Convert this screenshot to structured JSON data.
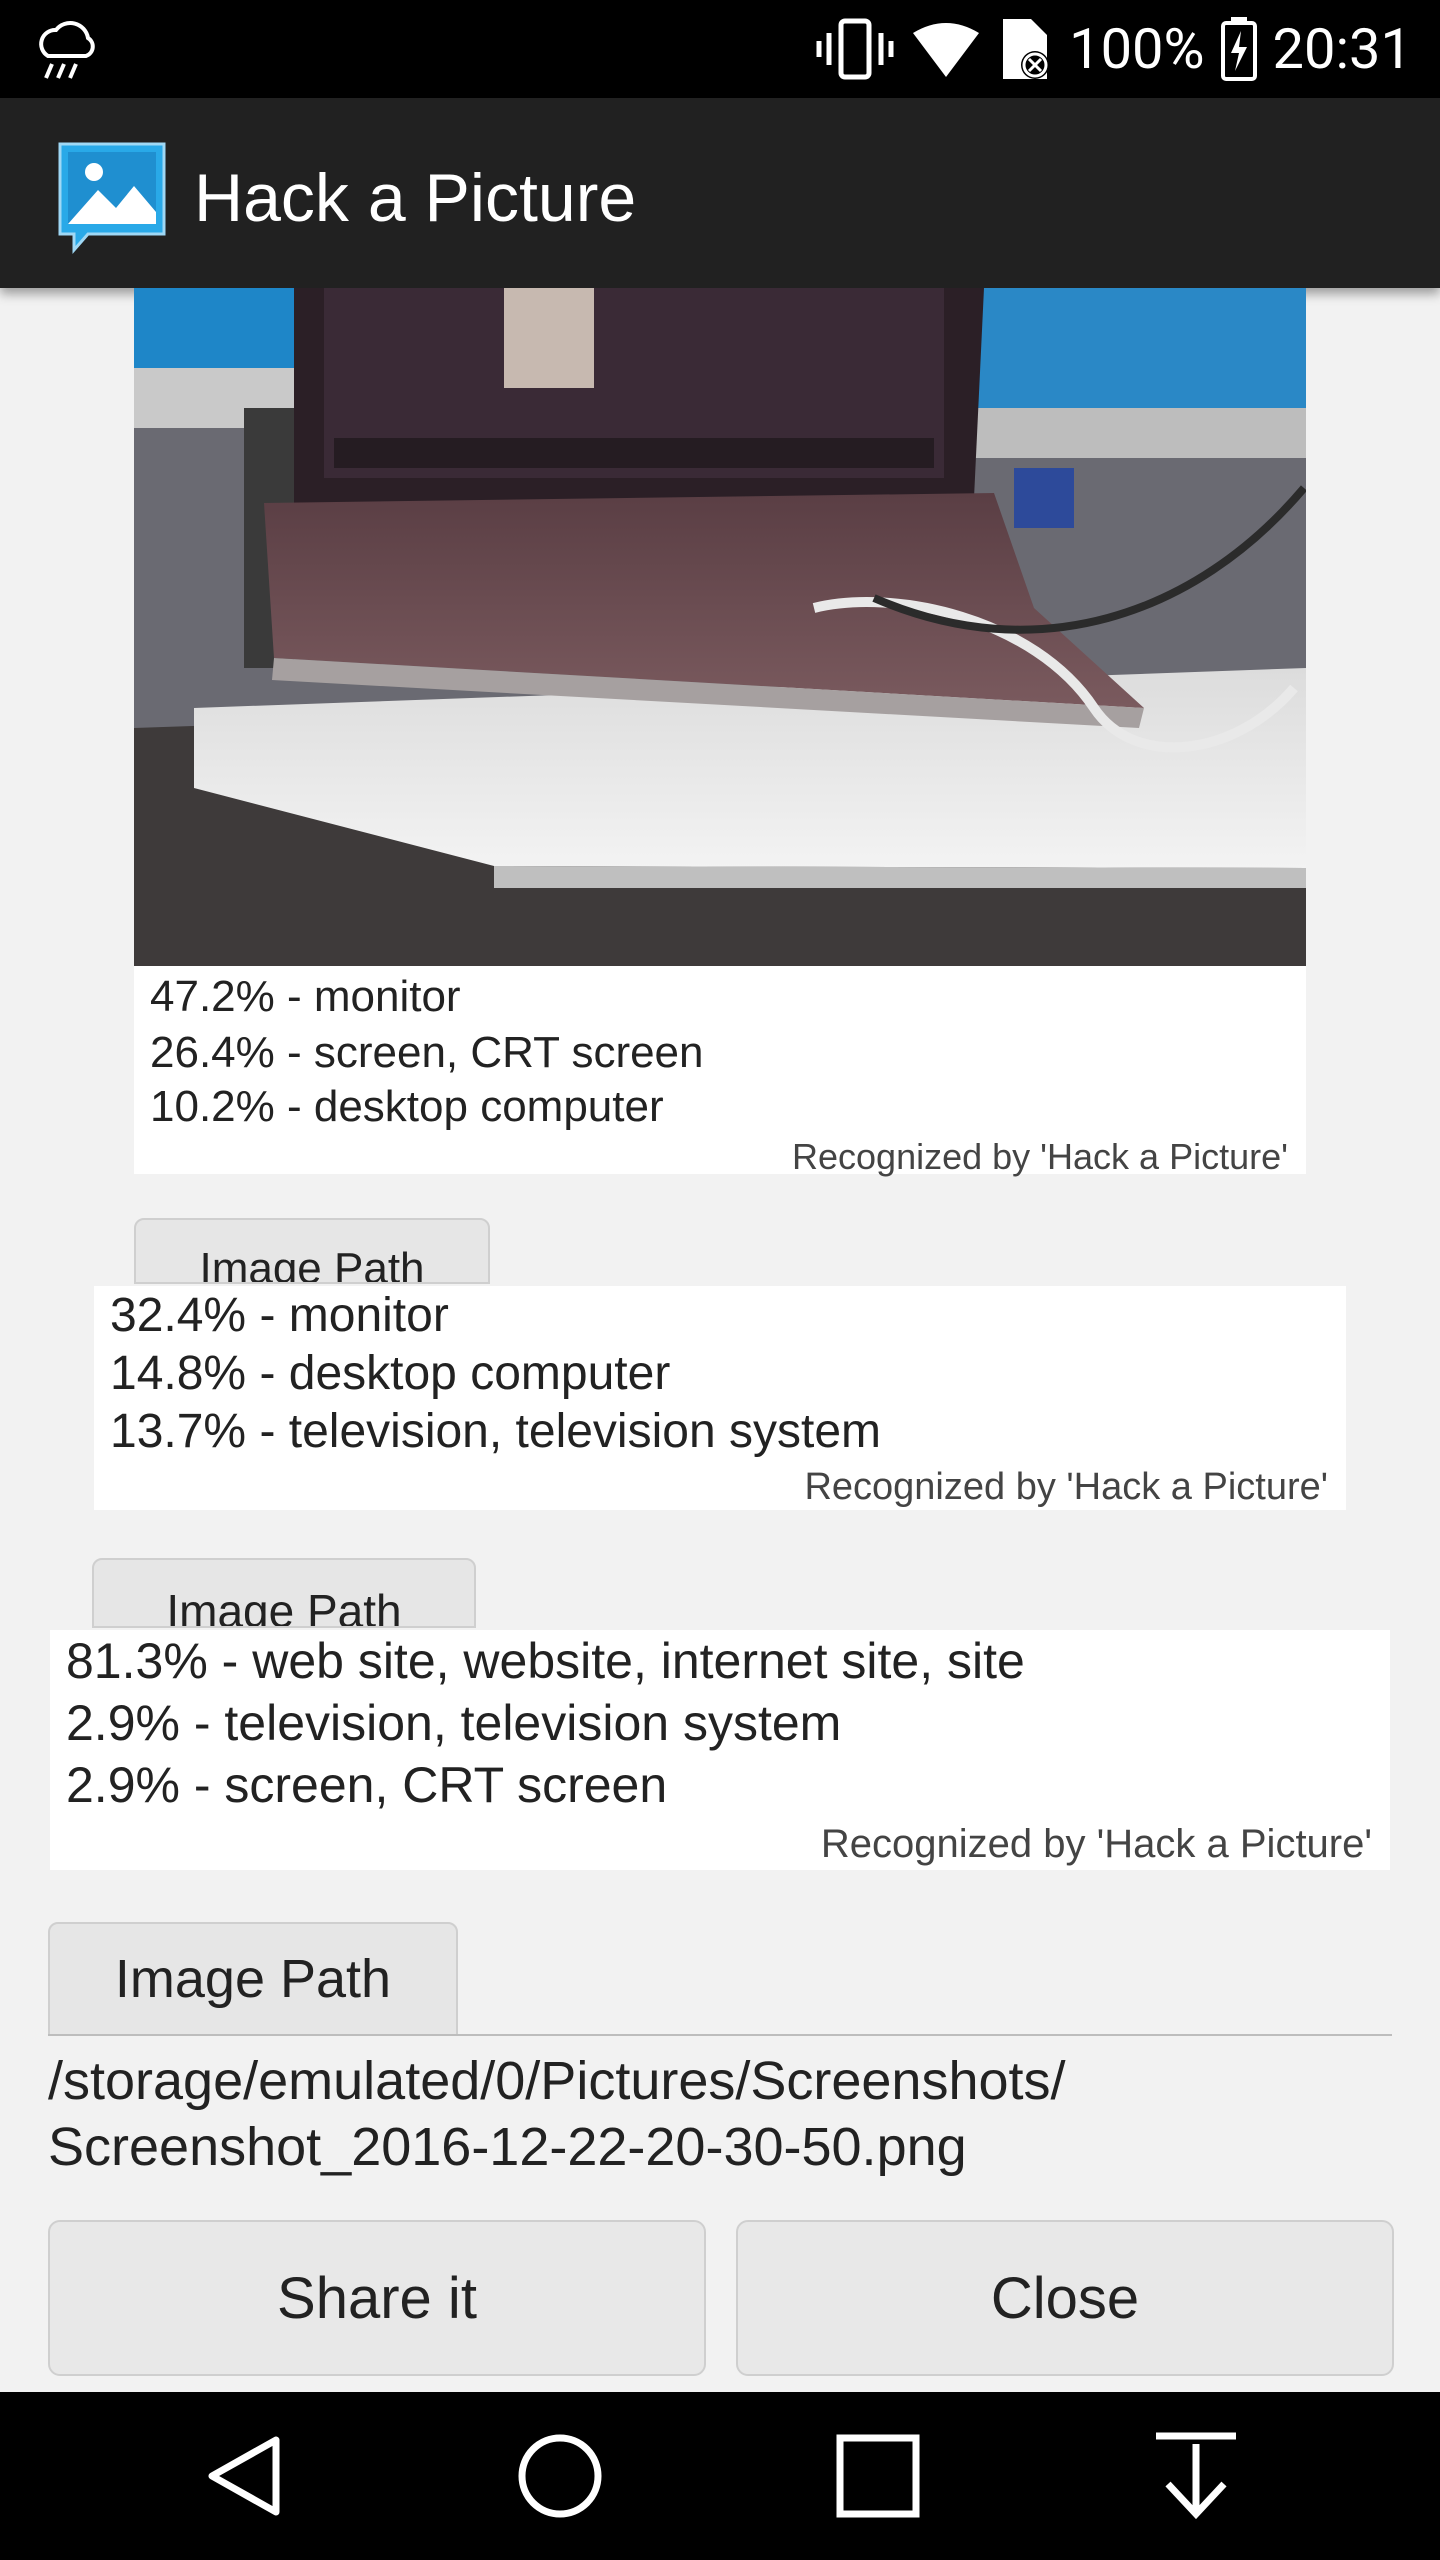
{
  "status_bar": {
    "battery": "100%",
    "time": "20:31",
    "icons": [
      "weather-rain-icon",
      "vibrate-icon",
      "wifi-icon",
      "sim-off-icon",
      "battery-charging-icon"
    ]
  },
  "app_bar": {
    "title": "Hack a Picture",
    "icon": "picture-chat-icon"
  },
  "results": [
    {
      "lines": [
        "47.2% - monitor",
        "26.4% - screen, CRT screen",
        "10.2% - desktop computer"
      ],
      "credit": "Recognized by 'Hack a Picture'",
      "button": "Image Path"
    },
    {
      "lines": [
        "32.4% - monitor",
        "14.8% - desktop computer",
        "13.7% - television, television system"
      ],
      "credit": "Recognized by 'Hack a Picture'",
      "button": "Image Path"
    },
    {
      "lines": [
        "81.3% - web site, website, internet site, site",
        "2.9% - television, television system",
        "2.9% - screen, CRT screen"
      ],
      "credit": "Recognized by 'Hack a Picture'",
      "button": "Image Path"
    }
  ],
  "path": {
    "line1": "/storage/emulated/0/Pictures/Screenshots/",
    "line2": "Screenshot_2016-12-22-20-30-50.png"
  },
  "actions": {
    "share": "Share it",
    "close": "Close"
  },
  "nav": [
    "back-icon",
    "home-icon",
    "recents-icon",
    "download-icon"
  ]
}
